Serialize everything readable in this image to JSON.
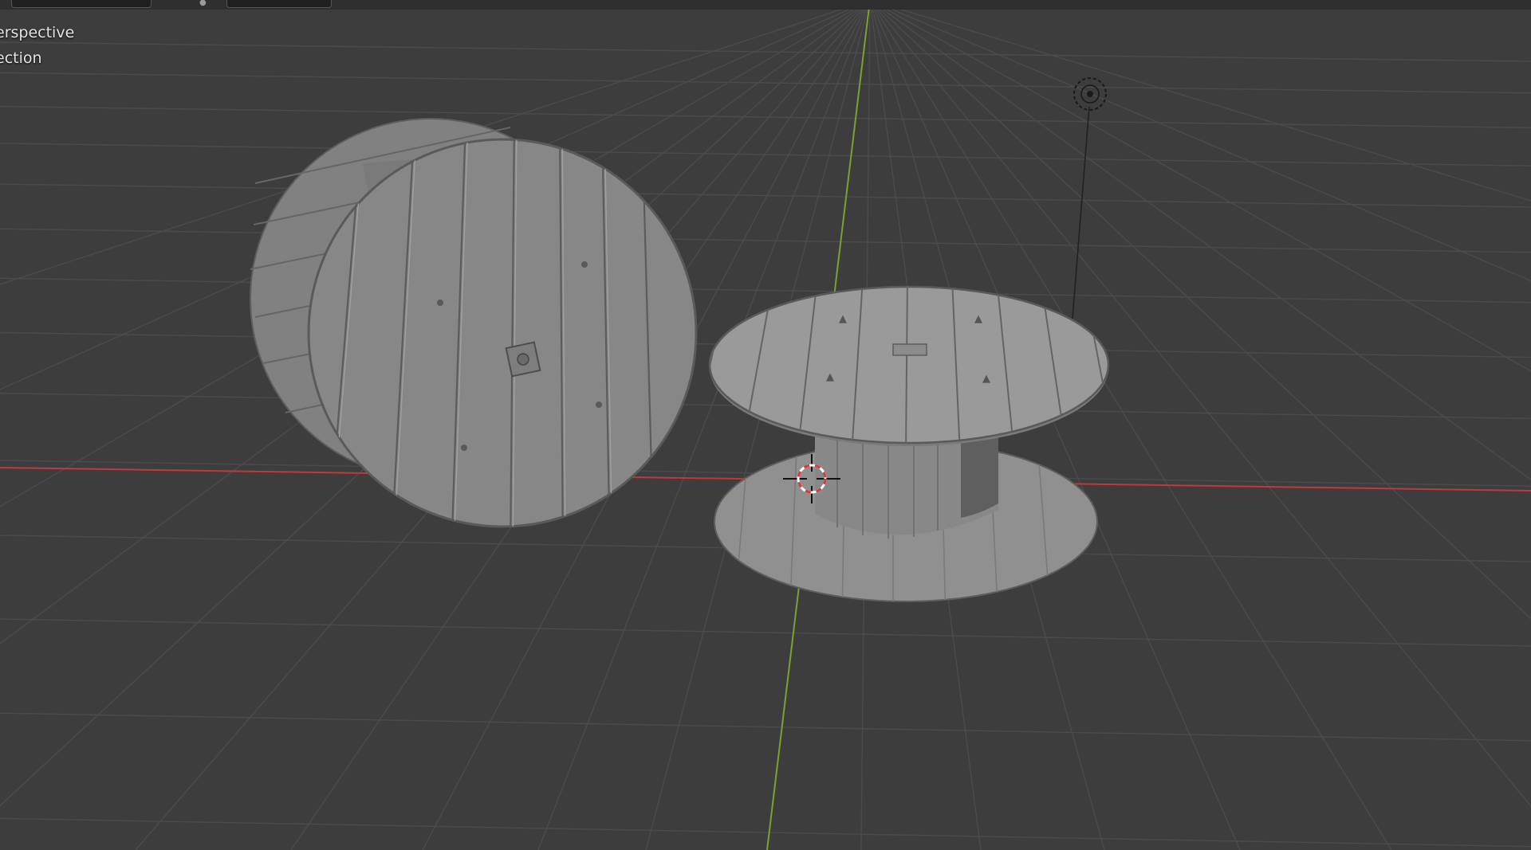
{
  "viewport": {
    "overlay_line1": "erspective",
    "overlay_line2": "ection"
  },
  "header": {
    "field1_value": "",
    "field2_value": ""
  },
  "colors": {
    "background": "#3d3d3d",
    "grid": "#4c4c4c",
    "x_axis": "#c0393b",
    "y_axis": "#7aa22f",
    "object_face": "#878787",
    "object_light": "#9a9a9a",
    "object_dark": "#6f6f6f",
    "outline": "#5a5a5a",
    "cursor_ring": "#d83a3a"
  },
  "icons": {
    "cursor": "3d-cursor-icon",
    "light": "light-icon"
  }
}
